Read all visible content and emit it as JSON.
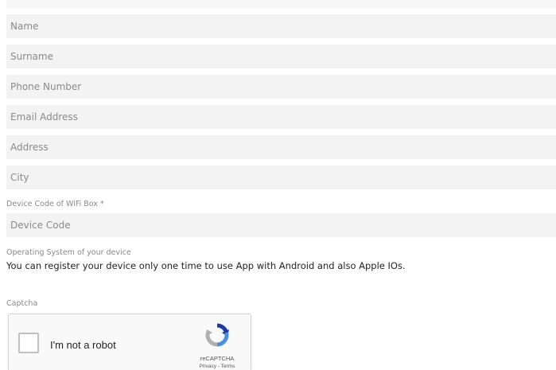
{
  "form": {
    "fields": [
      {
        "placeholder": "Name"
      },
      {
        "placeholder": "Surname"
      },
      {
        "placeholder": "Phone Number"
      },
      {
        "placeholder": "Email Address"
      },
      {
        "placeholder": "Address"
      },
      {
        "placeholder": "City"
      }
    ],
    "device_code_label": "Device Code of WiFi Box *",
    "device_code_placeholder": "Device Code",
    "os_label": "Operating System of your device",
    "os_notice": "You can register your device only one time to use App with Android and also Apple IOs.",
    "captcha_label": "Captcha"
  },
  "recaptcha": {
    "checkbox_text": "I'm not a robot",
    "brand": "reCAPTCHA",
    "privacy": "Privacy",
    "separator": " - ",
    "terms": "Terms",
    "icon": "recaptcha-logo-icon",
    "colors": {
      "blue_dark": "#1c3aa9",
      "blue_light": "#4a90e2",
      "gray": "#b0b0b0"
    }
  }
}
